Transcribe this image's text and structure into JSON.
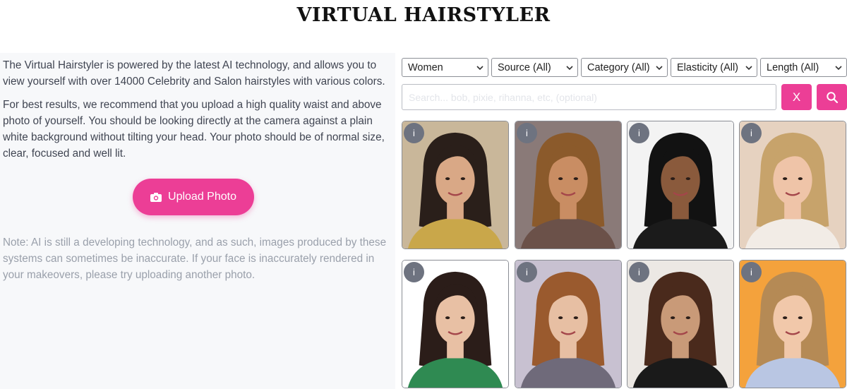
{
  "page": {
    "title": "VIRTUAL HAIRSTYLER"
  },
  "left_panel": {
    "intro": "The Virtual Hairstyler is powered by the latest AI technology, and allows you to view yourself with over 14000 Celebrity and Salon hairstyles with various colors.",
    "tips": "For best results, we recommend that you upload a high quality waist and above photo of yourself. You should be looking directly at the camera against a plain white background without tilting your head. Your photo should be of normal size, clear, focused and well lit.",
    "upload_label": "Upload Photo",
    "upload_icon": "camera-icon",
    "note": "Note: AI is still a developing technology, and as such, images produced by these systems can sometimes be inaccurate. If your face is inaccurately rendered in your makeovers, please try uploading another photo."
  },
  "filters": {
    "gender": "Women",
    "source": "Source (All)",
    "category": "Category (All)",
    "elasticity": "Elasticity (All)",
    "length": "Length (All)"
  },
  "search": {
    "placeholder": "Search... bob, pixie, rihanna, etc, (optional)",
    "clear_label": "X",
    "search_icon": "magnifier-icon"
  },
  "colors": {
    "accent": "#ec3e96",
    "badge": "#6e7380",
    "panel_bg": "#f7f8fa"
  },
  "cards": [
    {
      "info": "i",
      "bg": "#c9b79a",
      "hair": "#2a1f1a",
      "skin": "#d9a886",
      "top": "#c9a74a"
    },
    {
      "info": "i",
      "bg": "#8a7a78",
      "hair": "#8b5a2b",
      "skin": "#c98d63",
      "top": "#6b5149"
    },
    {
      "info": "i",
      "bg": "#f3f3f3",
      "hair": "#121212",
      "skin": "#8a5a3c",
      "top": "#1b1b1b"
    },
    {
      "info": "i",
      "bg": "#e6d2c0",
      "hair": "#c7a36b",
      "skin": "#efc4a8",
      "top": "#f2ece6"
    },
    {
      "info": "i",
      "bg": "#ffffff",
      "hair": "#2b1d19",
      "skin": "#e8c0a4",
      "top": "#2f8a52"
    },
    {
      "info": "i",
      "bg": "#c8c1d1",
      "hair": "#9a5a2e",
      "skin": "#e7bfa3",
      "top": "#6f6a7a"
    },
    {
      "info": "i",
      "bg": "#ece8e4",
      "hair": "#4a2a1c",
      "skin": "#c99a78",
      "top": "#1a1a1a"
    },
    {
      "info": "i",
      "bg": "#f4a23c",
      "hair": "#b58a55",
      "skin": "#f1c8aa",
      "top": "#b9c6e3"
    }
  ]
}
